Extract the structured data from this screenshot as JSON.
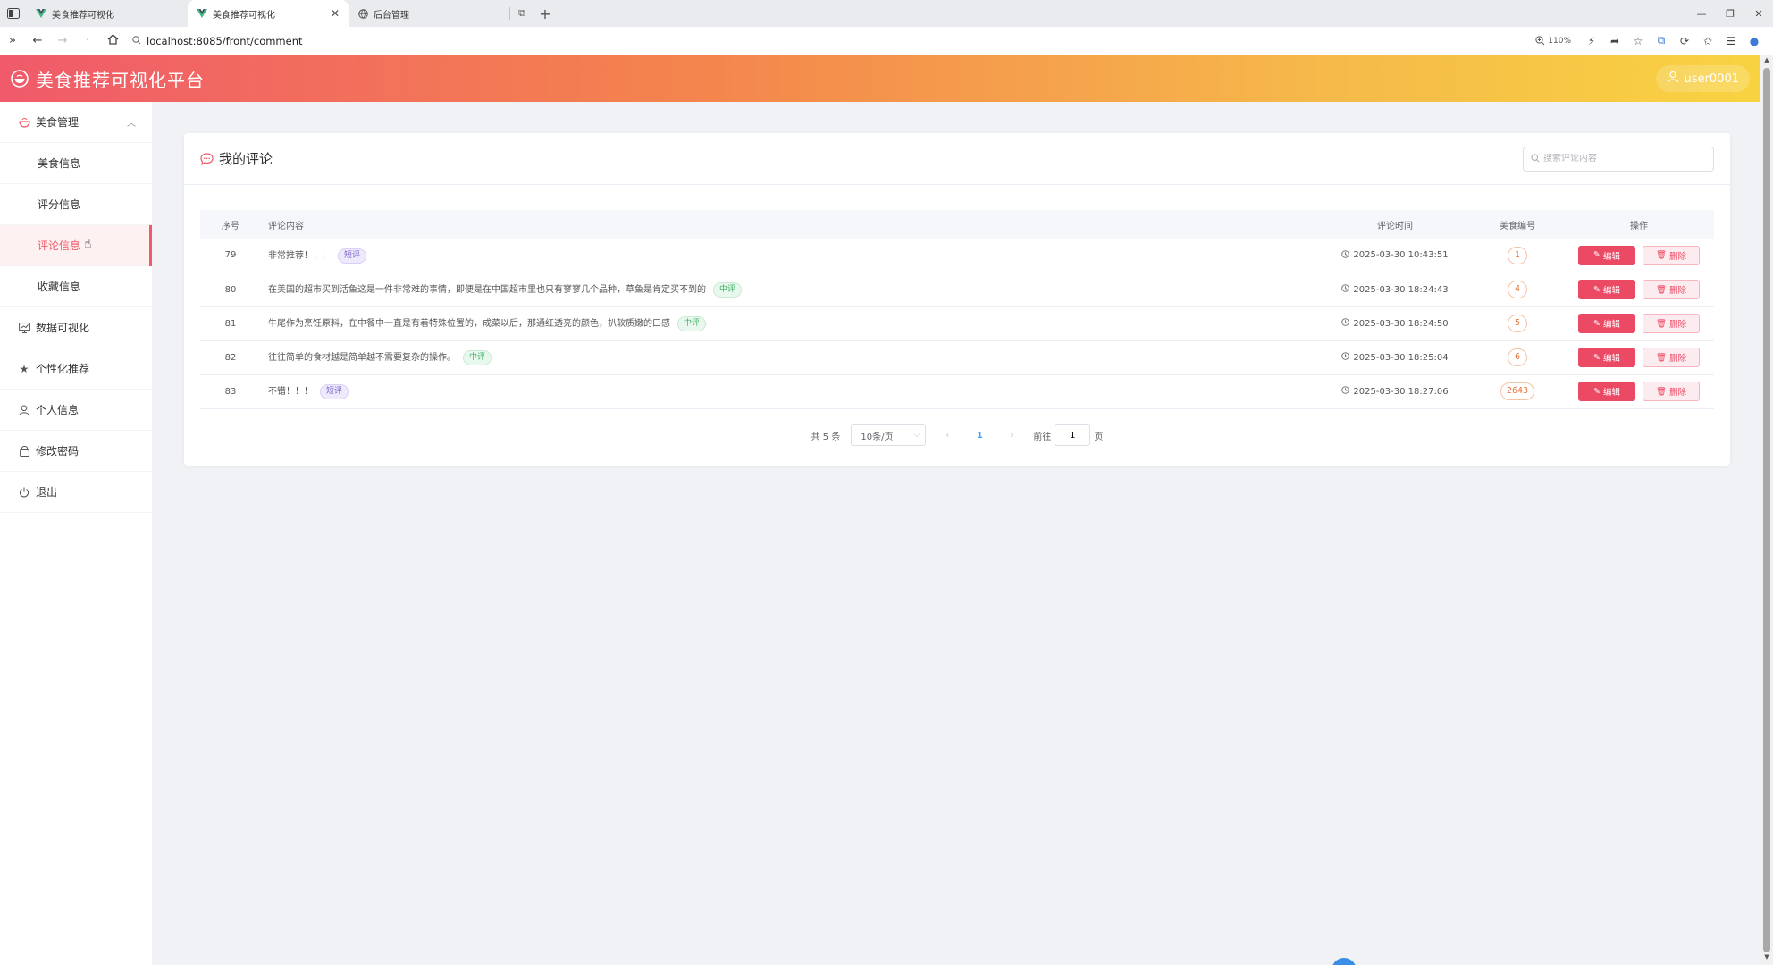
{
  "browser": {
    "tabs": [
      {
        "title": "美食推荐可视化",
        "active": false
      },
      {
        "title": "美食推荐可视化",
        "active": true
      },
      {
        "title": "后台管理",
        "active": false
      }
    ],
    "url": "localhost:8085/front/comment",
    "zoom": "110%"
  },
  "header": {
    "title": "美食推荐可视化平台",
    "user": "user0001"
  },
  "sidebar": {
    "group_label": "美食管理",
    "sub_items": [
      "美食信息",
      "评分信息",
      "评论信息",
      "收藏信息"
    ],
    "active_sub": "评论信息",
    "items": [
      "数据可视化",
      "个性化推荐",
      "个人信息",
      "修改密码",
      "退出"
    ]
  },
  "card": {
    "title": "我的评论",
    "search_placeholder": "搜索评论内容"
  },
  "table": {
    "headers": {
      "no": "序号",
      "content": "评论内容",
      "time": "评论时间",
      "food": "美食编号",
      "op": "操作"
    },
    "rows": [
      {
        "no": "79",
        "content": "非常推荐！！！",
        "tag": "短评",
        "tag_type": "short",
        "time": "2025-03-30 10:43:51",
        "food": "1"
      },
      {
        "no": "80",
        "content": "在美国的超市买到活鱼这是一件非常难的事情，即便是在中国超市里也只有寥寥几个品种，草鱼是肯定买不到的",
        "tag": "中评",
        "tag_type": "mid",
        "time": "2025-03-30 18:24:43",
        "food": "4"
      },
      {
        "no": "81",
        "content": "牛尾作为烹饪原料，在中餐中一直是有着特殊位置的，成菜以后，那通红透亮的颜色，扒软质嫩的口感",
        "tag": "中评",
        "tag_type": "mid",
        "time": "2025-03-30 18:24:50",
        "food": "5"
      },
      {
        "no": "82",
        "content": "往往简单的食材越是简单越不需要复杂的操作。",
        "tag": "中评",
        "tag_type": "mid",
        "time": "2025-03-30 18:25:04",
        "food": "6"
      },
      {
        "no": "83",
        "content": "不错！！！",
        "tag": "短评",
        "tag_type": "short",
        "time": "2025-03-30 18:27:06",
        "food": "2643"
      }
    ],
    "edit_label": "编辑",
    "delete_label": "删除"
  },
  "pagination": {
    "total": "共 5 条",
    "page_size": "10条/页",
    "current": "1",
    "goto_prefix": "前往",
    "goto_value": "1",
    "goto_suffix": "页"
  },
  "colors": {
    "accent": "#f05a6a",
    "header_gradient_end": "#f8d341",
    "edit_button": "#ec4a64"
  }
}
